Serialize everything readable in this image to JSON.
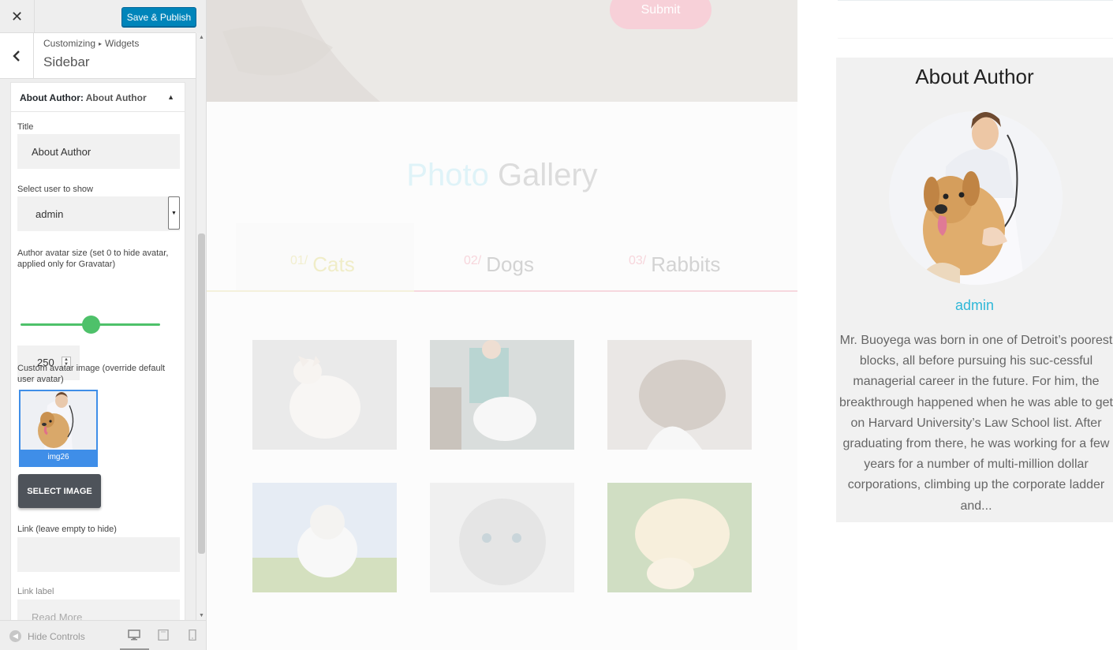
{
  "customizer": {
    "close_symbol": "✕",
    "publish_label": "Save & Publish",
    "back_symbol": "‹",
    "breadcrumb": [
      "Customizing",
      "Widgets"
    ],
    "breadcrumb_sep": "▸",
    "section_title": "Sidebar",
    "widget": {
      "name": "About Author:",
      "title": "About Author",
      "toggle_symbol": "▲"
    },
    "fields": {
      "title_label": "Title",
      "title_value": "About Author",
      "user_label": "Select user to show",
      "user_value": "admin",
      "avatar_size_label": "Author avatar size (set 0 to hide avatar, applied only for Gravatar)",
      "avatar_size_fraction": 0.5,
      "avatar_size_value": "250",
      "custom_avatar_label": "Custom avatar image (override default user avatar)",
      "custom_avatar_caption": "img26",
      "select_image_label": "SELECT IMAGE",
      "link_label": "Link (leave empty to hide)",
      "link_value": "",
      "link_text_label": "Link label",
      "link_text_placeholder": "Read More"
    },
    "footer": {
      "hide_controls_label": "Hide Controls"
    }
  },
  "preview": {
    "submit_label": "Submit",
    "gallery_title_a": "Photo",
    "gallery_title_b": "Gallery",
    "tabs": [
      {
        "num": "01/",
        "label": "Cats"
      },
      {
        "num": "02/",
        "label": "Dogs"
      },
      {
        "num": "03/",
        "label": "Rabbits"
      }
    ],
    "colors": {
      "accent_green": "#4ec16a",
      "accent_blue": "#0085ba",
      "name_cyan": "#2fb8d8"
    }
  },
  "about": {
    "title": "About Author",
    "name": "admin",
    "bio": "Mr. Buoyega was born in one of Detroit’s poorest blocks, all before pursuing his suc-cessful managerial career in the future. For him, the breakthrough happened when he was able to get on Harvard University’s Law School list. After graduating from there, he was working for a few years for a number of multi-million dollar corporations, climbing up the corporate ladder and..."
  }
}
